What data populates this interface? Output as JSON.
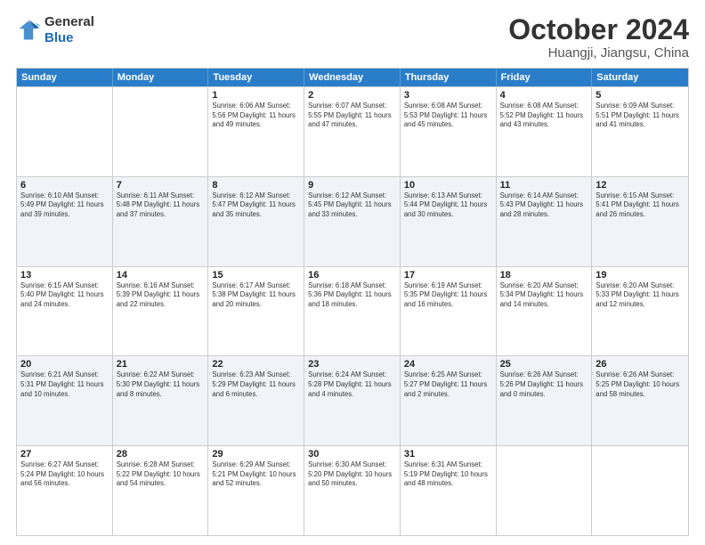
{
  "header": {
    "logo_line1": "General",
    "logo_line2": "Blue",
    "month": "October 2024",
    "location": "Huangji, Jiangsu, China"
  },
  "days_of_week": [
    "Sunday",
    "Monday",
    "Tuesday",
    "Wednesday",
    "Thursday",
    "Friday",
    "Saturday"
  ],
  "rows": [
    {
      "alt": false,
      "cells": [
        {
          "day": "",
          "info": ""
        },
        {
          "day": "",
          "info": ""
        },
        {
          "day": "1",
          "info": "Sunrise: 6:06 AM\nSunset: 5:56 PM\nDaylight: 11 hours and 49 minutes."
        },
        {
          "day": "2",
          "info": "Sunrise: 6:07 AM\nSunset: 5:55 PM\nDaylight: 11 hours and 47 minutes."
        },
        {
          "day": "3",
          "info": "Sunrise: 6:08 AM\nSunset: 5:53 PM\nDaylight: 11 hours and 45 minutes."
        },
        {
          "day": "4",
          "info": "Sunrise: 6:08 AM\nSunset: 5:52 PM\nDaylight: 11 hours and 43 minutes."
        },
        {
          "day": "5",
          "info": "Sunrise: 6:09 AM\nSunset: 5:51 PM\nDaylight: 11 hours and 41 minutes."
        }
      ]
    },
    {
      "alt": true,
      "cells": [
        {
          "day": "6",
          "info": "Sunrise: 6:10 AM\nSunset: 5:49 PM\nDaylight: 11 hours and 39 minutes."
        },
        {
          "day": "7",
          "info": "Sunrise: 6:11 AM\nSunset: 5:48 PM\nDaylight: 11 hours and 37 minutes."
        },
        {
          "day": "8",
          "info": "Sunrise: 6:12 AM\nSunset: 5:47 PM\nDaylight: 11 hours and 35 minutes."
        },
        {
          "day": "9",
          "info": "Sunrise: 6:12 AM\nSunset: 5:45 PM\nDaylight: 11 hours and 33 minutes."
        },
        {
          "day": "10",
          "info": "Sunrise: 6:13 AM\nSunset: 5:44 PM\nDaylight: 11 hours and 30 minutes."
        },
        {
          "day": "11",
          "info": "Sunrise: 6:14 AM\nSunset: 5:43 PM\nDaylight: 11 hours and 28 minutes."
        },
        {
          "day": "12",
          "info": "Sunrise: 6:15 AM\nSunset: 5:41 PM\nDaylight: 11 hours and 26 minutes."
        }
      ]
    },
    {
      "alt": false,
      "cells": [
        {
          "day": "13",
          "info": "Sunrise: 6:15 AM\nSunset: 5:40 PM\nDaylight: 11 hours and 24 minutes."
        },
        {
          "day": "14",
          "info": "Sunrise: 6:16 AM\nSunset: 5:39 PM\nDaylight: 11 hours and 22 minutes."
        },
        {
          "day": "15",
          "info": "Sunrise: 6:17 AM\nSunset: 5:38 PM\nDaylight: 11 hours and 20 minutes."
        },
        {
          "day": "16",
          "info": "Sunrise: 6:18 AM\nSunset: 5:36 PM\nDaylight: 11 hours and 18 minutes."
        },
        {
          "day": "17",
          "info": "Sunrise: 6:19 AM\nSunset: 5:35 PM\nDaylight: 11 hours and 16 minutes."
        },
        {
          "day": "18",
          "info": "Sunrise: 6:20 AM\nSunset: 5:34 PM\nDaylight: 11 hours and 14 minutes."
        },
        {
          "day": "19",
          "info": "Sunrise: 6:20 AM\nSunset: 5:33 PM\nDaylight: 11 hours and 12 minutes."
        }
      ]
    },
    {
      "alt": true,
      "cells": [
        {
          "day": "20",
          "info": "Sunrise: 6:21 AM\nSunset: 5:31 PM\nDaylight: 11 hours and 10 minutes."
        },
        {
          "day": "21",
          "info": "Sunrise: 6:22 AM\nSunset: 5:30 PM\nDaylight: 11 hours and 8 minutes."
        },
        {
          "day": "22",
          "info": "Sunrise: 6:23 AM\nSunset: 5:29 PM\nDaylight: 11 hours and 6 minutes."
        },
        {
          "day": "23",
          "info": "Sunrise: 6:24 AM\nSunset: 5:28 PM\nDaylight: 11 hours and 4 minutes."
        },
        {
          "day": "24",
          "info": "Sunrise: 6:25 AM\nSunset: 5:27 PM\nDaylight: 11 hours and 2 minutes."
        },
        {
          "day": "25",
          "info": "Sunrise: 6:26 AM\nSunset: 5:26 PM\nDaylight: 11 hours and 0 minutes."
        },
        {
          "day": "26",
          "info": "Sunrise: 6:26 AM\nSunset: 5:25 PM\nDaylight: 10 hours and 58 minutes."
        }
      ]
    },
    {
      "alt": false,
      "cells": [
        {
          "day": "27",
          "info": "Sunrise: 6:27 AM\nSunset: 5:24 PM\nDaylight: 10 hours and 56 minutes."
        },
        {
          "day": "28",
          "info": "Sunrise: 6:28 AM\nSunset: 5:22 PM\nDaylight: 10 hours and 54 minutes."
        },
        {
          "day": "29",
          "info": "Sunrise: 6:29 AM\nSunset: 5:21 PM\nDaylight: 10 hours and 52 minutes."
        },
        {
          "day": "30",
          "info": "Sunrise: 6:30 AM\nSunset: 5:20 PM\nDaylight: 10 hours and 50 minutes."
        },
        {
          "day": "31",
          "info": "Sunrise: 6:31 AM\nSunset: 5:19 PM\nDaylight: 10 hours and 48 minutes."
        },
        {
          "day": "",
          "info": ""
        },
        {
          "day": "",
          "info": ""
        }
      ]
    }
  ]
}
